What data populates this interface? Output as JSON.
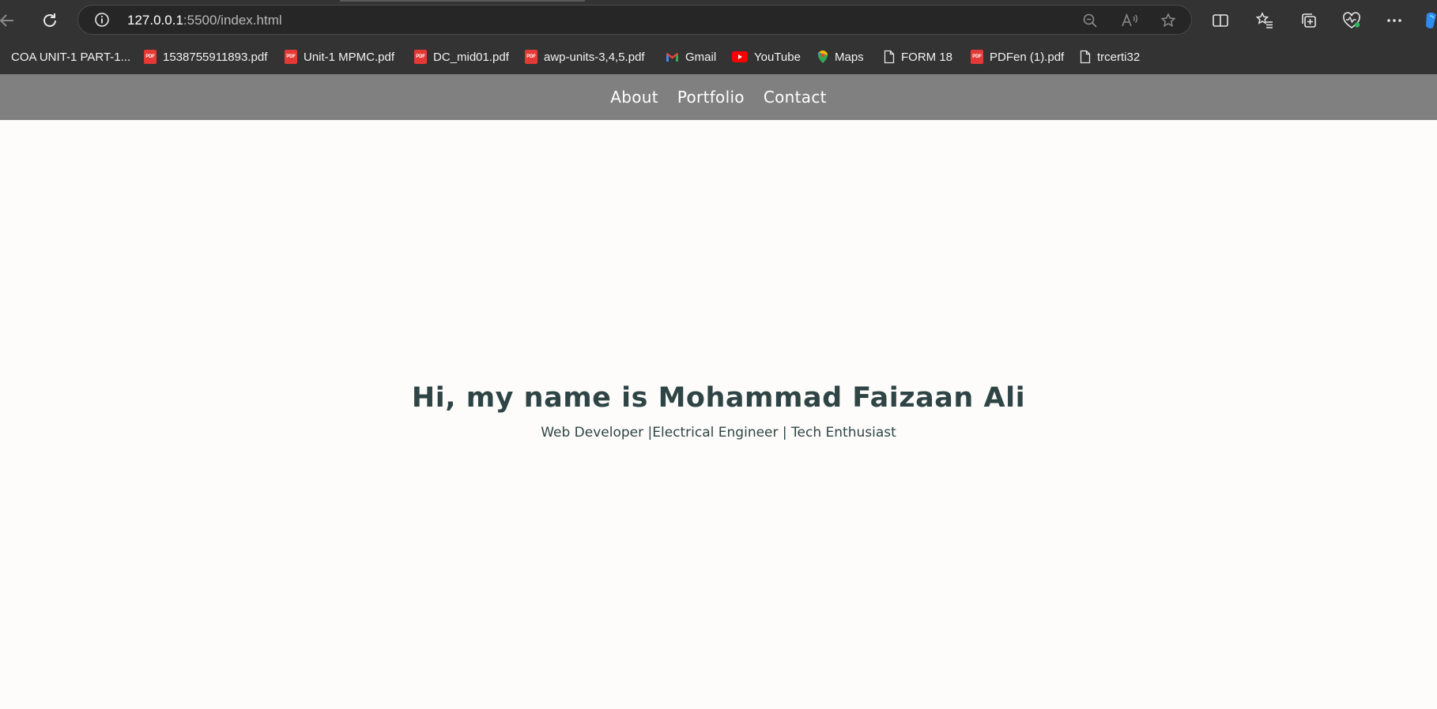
{
  "browser": {
    "url_host": "127.0.0.1",
    "url_path": ":5500/index.html",
    "bookmarks": [
      {
        "label": "COA UNIT-1 PART-1...",
        "icon": "pdf-icon"
      },
      {
        "label": "1538755911893.pdf",
        "icon": "pdf-icon"
      },
      {
        "label": "Unit-1 MPMC.pdf",
        "icon": "pdf-icon"
      },
      {
        "label": "DC_mid01.pdf",
        "icon": "pdf-icon"
      },
      {
        "label": "awp-units-3,4,5.pdf",
        "icon": "pdf-icon"
      },
      {
        "label": "Gmail",
        "icon": "gmail-icon"
      },
      {
        "label": "YouTube",
        "icon": "youtube-icon"
      },
      {
        "label": "Maps",
        "icon": "maps-icon"
      },
      {
        "label": "FORM 18",
        "icon": "page-icon"
      },
      {
        "label": "PDFen (1).pdf",
        "icon": "pdf-icon"
      },
      {
        "label": "trcerti32",
        "icon": "page-icon"
      }
    ],
    "pdf_badge": "PDF"
  },
  "site": {
    "nav": [
      "About",
      "Portfolio",
      "Contact"
    ],
    "heading": "Hi, my name is Mohammad Faizaan Ali",
    "tagline": "Web Developer |Electrical Engineer | Tech Enthusiast"
  },
  "colors": {
    "chrome_bg": "#333333",
    "site_nav_bg": "#808080",
    "page_bg": "#fdfcfb",
    "heading_text": "#2f4545"
  }
}
